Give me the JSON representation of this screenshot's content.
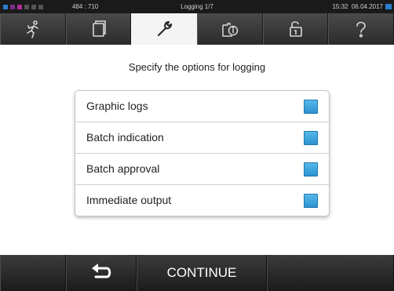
{
  "statusbar": {
    "counter": "484 : 710",
    "title": "Logging 1/7",
    "time": "15:32",
    "date": "06.04.2017"
  },
  "navbar": {
    "tabs": [
      {
        "icon": "running-person-icon",
        "active": false
      },
      {
        "icon": "document-icon",
        "active": false
      },
      {
        "icon": "wrench-icon",
        "active": true
      },
      {
        "icon": "info-clipboard-icon",
        "active": false
      },
      {
        "icon": "unlock-icon",
        "active": false
      },
      {
        "icon": "help-icon",
        "active": false
      }
    ]
  },
  "main": {
    "instruction": "Specify the options for logging",
    "options": [
      {
        "label": "Graphic logs",
        "checked": true
      },
      {
        "label": "Batch indication",
        "checked": true
      },
      {
        "label": "Batch approval",
        "checked": true
      },
      {
        "label": "Immediate output",
        "checked": true
      }
    ]
  },
  "footer": {
    "back_icon": "back-arrow-icon",
    "continue_label": "CONTINUE"
  },
  "colors": {
    "accent": "#2b93cf",
    "bar_dark": "#1a1a1a"
  }
}
